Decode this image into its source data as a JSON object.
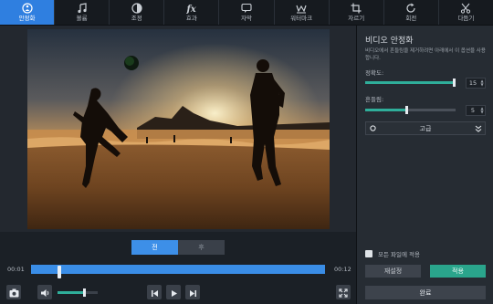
{
  "toolbar": {
    "tools": [
      {
        "label": "안정화",
        "icon": "stabilize-icon"
      },
      {
        "label": "볼륨",
        "icon": "music-note-icon"
      },
      {
        "label": "조정",
        "icon": "contrast-icon"
      },
      {
        "label": "효과",
        "icon": "fx-icon"
      },
      {
        "label": "자막",
        "icon": "speech-bubble-icon"
      },
      {
        "label": "워터마크",
        "icon": "watermark-icon"
      },
      {
        "label": "자르기",
        "icon": "crop-icon"
      },
      {
        "label": "회전",
        "icon": "rotate-icon"
      },
      {
        "label": "다듬기",
        "icon": "scissors-icon"
      }
    ],
    "active_index": 0
  },
  "preview": {
    "toggle_before": "전",
    "toggle_after": "후"
  },
  "timeline": {
    "current_time": "00:01",
    "total_time": "00:12",
    "playhead_fraction": 0.09
  },
  "controls": {
    "volume_fraction": 0.65
  },
  "panel": {
    "title": "비디오 안정화",
    "description": "비디오에서 흔들림을 제거하려면 아래에서 이 옵션을 사용합니다.",
    "accuracy_label": "정확도:",
    "accuracy_value": "15",
    "accuracy_fraction": 1.0,
    "shakiness_label": "흔들림:",
    "shakiness_value": "5",
    "shakiness_fraction": 0.45,
    "advanced_label": "고급",
    "apply_all_label": "모든 파일에 적용",
    "reset_label": "재설정",
    "apply_label": "적용",
    "done_label": "완료"
  },
  "colors": {
    "accent_blue": "#2f7fe0",
    "accent_green": "#2aa58c",
    "panel_bg": "#262c33"
  }
}
